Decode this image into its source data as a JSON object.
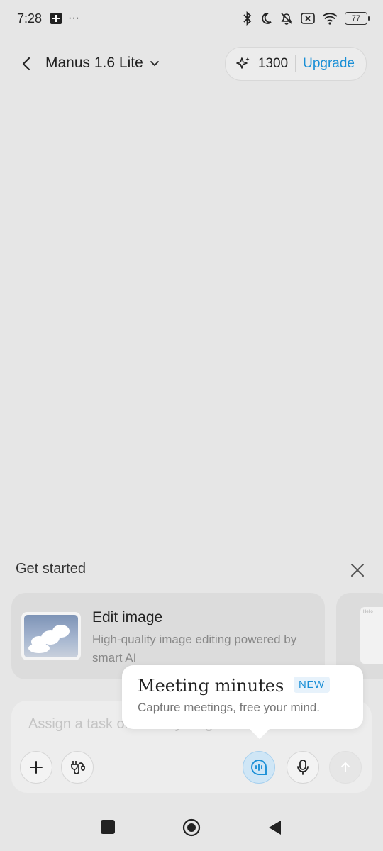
{
  "status_bar": {
    "time": "7:28",
    "more": "···",
    "battery": "77"
  },
  "header": {
    "model_name": "Manus 1.6 Lite",
    "credits": "1300",
    "upgrade_label": "Upgrade"
  },
  "get_started": {
    "title": "Get started",
    "cards": [
      {
        "title": "Edit image",
        "description": "High-quality image editing powered by smart AI"
      }
    ],
    "peek_card_text": "Hello"
  },
  "composer": {
    "placeholder": "Assign a task or ask anything"
  },
  "tooltip": {
    "title": "Meeting minutes",
    "badge": "NEW",
    "description": "Capture meetings, free your mind."
  },
  "colors": {
    "accent": "#1a8fd6",
    "background": "#e6e6e6"
  }
}
